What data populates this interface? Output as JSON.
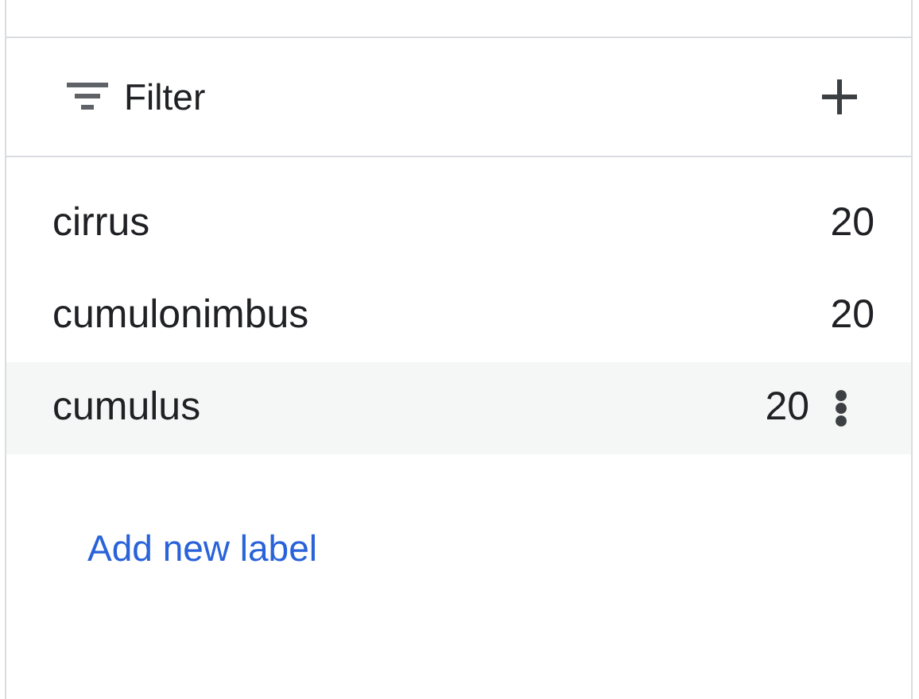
{
  "filter": {
    "label": "Filter"
  },
  "labels": [
    {
      "name": "cirrus",
      "count": "20",
      "hovered": false
    },
    {
      "name": "cumulonimbus",
      "count": "20",
      "hovered": false
    },
    {
      "name": "cumulus",
      "count": "20",
      "hovered": true
    }
  ],
  "add_link": "Add new label"
}
